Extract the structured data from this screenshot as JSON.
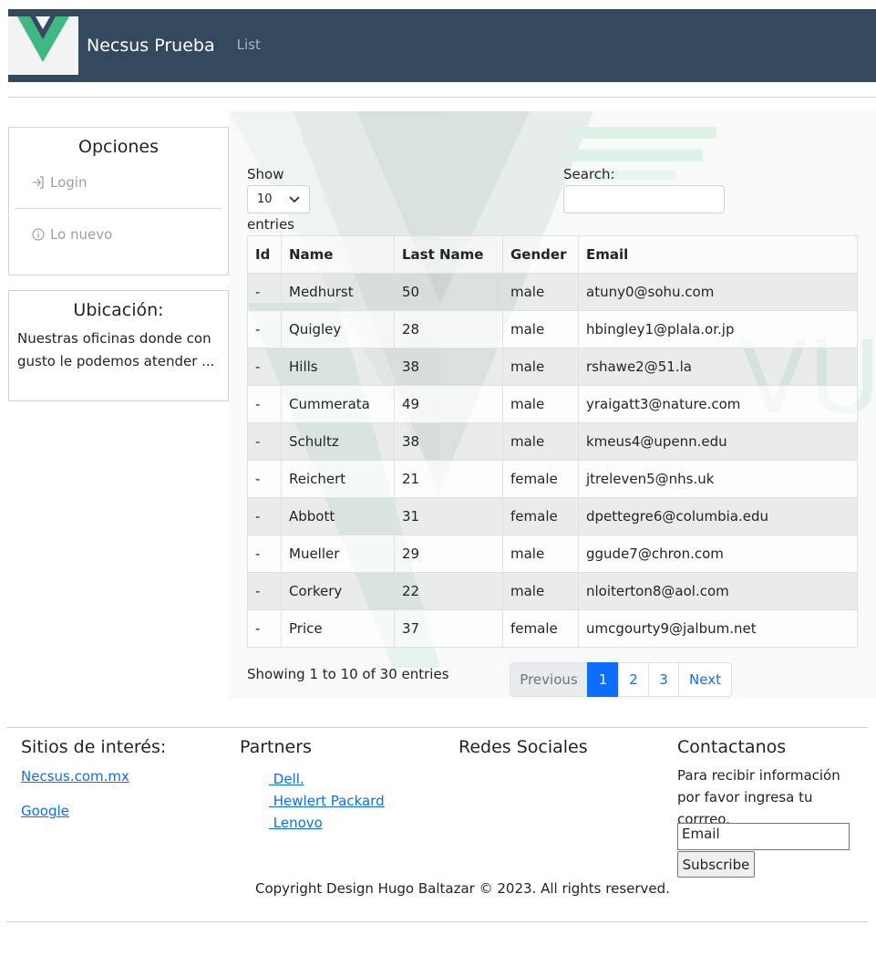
{
  "navbar": {
    "brand": "Necsus Prueba",
    "link": "List"
  },
  "sidebar": {
    "options_title": "Opciones",
    "items": [
      {
        "label": "Login",
        "icon": "login-icon"
      },
      {
        "label": "Lo nuevo",
        "icon": "info-icon"
      }
    ],
    "location_title": "Ubicación:",
    "location_text": "Nuestras oficinas donde con gusto le podemos atender ..."
  },
  "table_controls": {
    "show_label": "Show",
    "page_length": "10",
    "entries_label": "entries",
    "search_label": "Search:",
    "search_value": ""
  },
  "table": {
    "columns": [
      "Id",
      "Name",
      "Last Name",
      "Gender",
      "Email"
    ],
    "rows": [
      [
        "-",
        "Medhurst",
        "50",
        "male",
        "atuny0@sohu.com"
      ],
      [
        "-",
        "Quigley",
        "28",
        "male",
        "hbingley1@plala.or.jp"
      ],
      [
        "-",
        "Hills",
        "38",
        "male",
        "rshawe2@51.la"
      ],
      [
        "-",
        "Cummerata",
        "49",
        "male",
        "yraigatt3@nature.com"
      ],
      [
        "-",
        "Schultz",
        "38",
        "male",
        "kmeus4@upenn.edu"
      ],
      [
        "-",
        "Reichert",
        "21",
        "female",
        "jtreleven5@nhs.uk"
      ],
      [
        "-",
        "Abbott",
        "31",
        "female",
        "dpettegre6@columbia.edu"
      ],
      [
        "-",
        "Mueller",
        "29",
        "male",
        "ggude7@chron.com"
      ],
      [
        "-",
        "Corkery",
        "22",
        "male",
        "nloiterton8@aol.com"
      ],
      [
        "-",
        "Price",
        "37",
        "female",
        "umcgourty9@jalbum.net"
      ]
    ]
  },
  "table_info": "Showing 1 to 10 of 30 entries",
  "pagination": {
    "previous": "Previous",
    "pages": [
      "1",
      "2",
      "3"
    ],
    "next": "Next",
    "current": "1"
  },
  "footer": {
    "sites_title": "Sitios de interés:",
    "sites": [
      "Necsus.com.mx",
      "Google"
    ],
    "partners_title": "Partners",
    "partners": [
      " Dell.",
      " Hewlert Packard",
      " Lenovo"
    ],
    "social_title": "Redes Sociales",
    "contact_title": "Contactanos",
    "contact_text": "Para recibir información por favor ingresa tu corrreo.",
    "email_value": "Email",
    "subscribe_label": "Subscribe",
    "copyright": "Copyright Design Hugo Baltazar © 2023. All rights reserved."
  },
  "colors": {
    "navbar": "#35495e",
    "vue_green": "#41b883",
    "primary": "#0d6efd"
  }
}
